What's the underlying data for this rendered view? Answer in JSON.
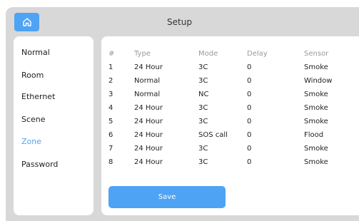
{
  "header": {
    "title": "Setup",
    "home_icon": "home-icon"
  },
  "sidebar": {
    "items": [
      {
        "label": "Normal"
      },
      {
        "label": "Room"
      },
      {
        "label": "Ethernet"
      },
      {
        "label": "Scene"
      },
      {
        "label": "Zone"
      },
      {
        "label": "Password"
      }
    ],
    "active": "Zone"
  },
  "table": {
    "headers": [
      "#",
      "Type",
      "Mode",
      "Delay",
      "Sensor"
    ],
    "rows": [
      [
        "1",
        "24 Hour",
        "3C",
        "0",
        "Smoke"
      ],
      [
        "2",
        "Normal",
        "3C",
        "0",
        "Window"
      ],
      [
        "3",
        "Normal",
        "NC",
        "0",
        "Smoke"
      ],
      [
        "4",
        "24 Hour",
        "3C",
        "0",
        "Smoke"
      ],
      [
        "5",
        "24 Hour",
        "3C",
        "0",
        "Smoke"
      ],
      [
        "6",
        "24 Hour",
        "SOS call",
        "0",
        "Flood"
      ],
      [
        "7",
        "24 Hour",
        "3C",
        "0",
        "Smoke"
      ],
      [
        "8",
        "24 Hour",
        "3C",
        "0",
        "Smoke"
      ]
    ]
  },
  "actions": {
    "save_label": "Save"
  },
  "colors": {
    "accent": "#4fa3f4",
    "background": "#d8d8d8",
    "panel": "#ffffff"
  }
}
